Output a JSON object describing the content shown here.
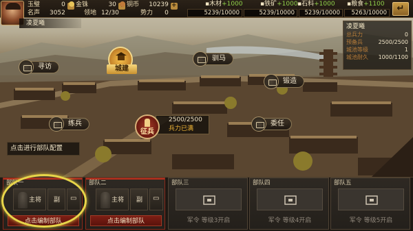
{
  "player": {
    "name": "凌夏曦",
    "stats": [
      {
        "label": "玉璧",
        "value": "0"
      },
      {
        "label": "金铢",
        "value": "30"
      },
      {
        "label": "铜币",
        "value": "10239"
      },
      {
        "label": "名声",
        "value": "3052"
      },
      {
        "label": "领地",
        "value": "12/30"
      },
      {
        "label": "势力",
        "value": "0"
      }
    ]
  },
  "resources": [
    {
      "name": "木材",
      "rate": "+1000",
      "amount": "5239/10000",
      "icon": "wood-icon"
    },
    {
      "name": "铁矿",
      "rate": "+1000",
      "amount": "5239/10000",
      "icon": "iron-icon"
    },
    {
      "name": "石料",
      "rate": "+1000",
      "amount": "5239/10000",
      "icon": "stone-icon"
    },
    {
      "name": "粮食",
      "rate": "+1100",
      "amount": "5263/10000",
      "icon": "grain-icon"
    }
  ],
  "city": {
    "title": "凌夏曦",
    "rows": [
      {
        "k": "总兵力",
        "v": "0"
      },
      {
        "k": "预备兵",
        "v": "2500/2500"
      },
      {
        "k": "城池等级",
        "v": "1"
      },
      {
        "k": "城池耐久",
        "v": "1000/1100"
      }
    ]
  },
  "buildings": {
    "xunfang": "寻访",
    "chengjian": "城建",
    "xunma": "驯马",
    "duanzao": "锻造",
    "lianbing": "练兵",
    "weiren": "委任",
    "zhengbing": "征兵"
  },
  "recruit": {
    "count": "2500/2500",
    "status": "兵力已满"
  },
  "hint": "点击进行部队配置",
  "troops": [
    {
      "title": "部队一",
      "general": "主将",
      "deputy": "副",
      "button": "点击编制部队",
      "state": "active"
    },
    {
      "title": "部队二",
      "general": "主将",
      "deputy": "副",
      "button": "点击编制部队",
      "state": "active"
    },
    {
      "title": "部队三",
      "button": "军令 等级3开启",
      "state": "locked"
    },
    {
      "title": "部队四",
      "button": "军令 等级4开启",
      "state": "locked"
    },
    {
      "title": "部队五",
      "button": "军令 等级5开启",
      "state": "locked"
    }
  ],
  "colors": {
    "accent": "#b3311f",
    "highlight": "#e7d54a",
    "gold": "#c5832a"
  }
}
